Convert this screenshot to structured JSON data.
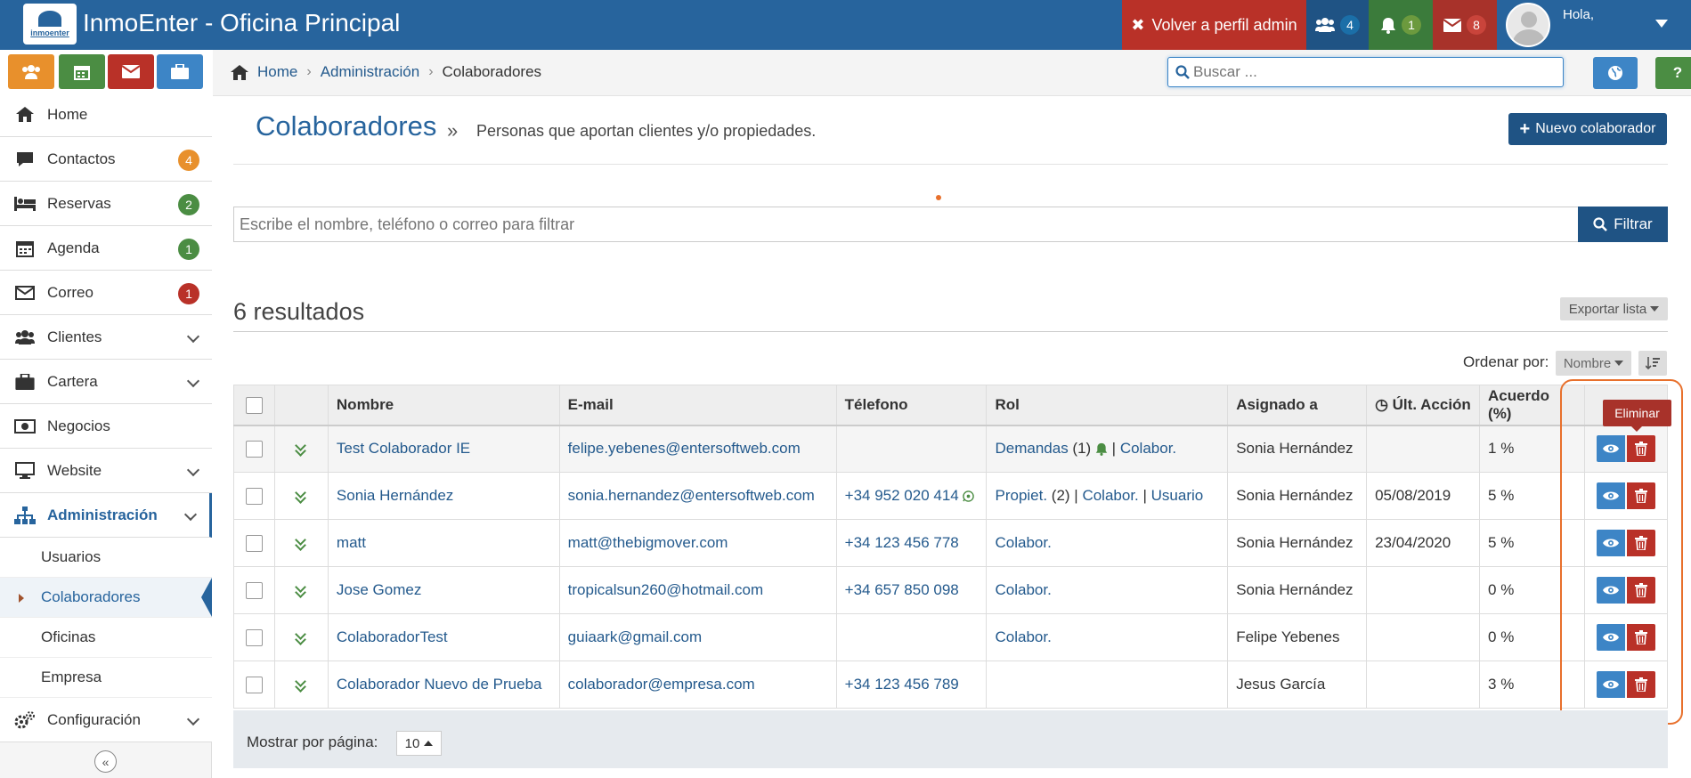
{
  "app": {
    "title": "InmoEnter - Oficina Principal",
    "logo_text": "inmoenter"
  },
  "topbar": {
    "admin_label": "Volver a perfil admin",
    "users_count": "4",
    "bell_count": "1",
    "mail_count": "8",
    "greeting": "Hola,"
  },
  "sidebar": {
    "items": [
      {
        "label": "Home"
      },
      {
        "label": "Contactos",
        "badge": "4"
      },
      {
        "label": "Reservas",
        "badge": "2"
      },
      {
        "label": "Agenda",
        "badge": "1"
      },
      {
        "label": "Correo",
        "badge": "1"
      },
      {
        "label": "Clientes"
      },
      {
        "label": "Cartera"
      },
      {
        "label": "Negocios"
      },
      {
        "label": "Website"
      },
      {
        "label": "Administración"
      },
      {
        "label": "Configuración"
      }
    ],
    "subitems": [
      {
        "label": "Usuarios"
      },
      {
        "label": "Colaboradores"
      },
      {
        "label": "Oficinas"
      },
      {
        "label": "Empresa"
      }
    ]
  },
  "breadcrumb": [
    "Home",
    "Administración",
    "Colaboradores"
  ],
  "search": {
    "placeholder": "Buscar ..."
  },
  "page": {
    "title": "Colaboradores",
    "sep": "»",
    "subtitle": "Personas que aportan clientes y/o propiedades.",
    "new_button": "Nuevo colaborador"
  },
  "filter": {
    "placeholder": "Escribe el nombre, teléfono o correo para filtrar",
    "button": "Filtrar"
  },
  "results": {
    "count_label": "6 resultados",
    "export_label": "Exportar lista",
    "sort_label": "Ordenar por:",
    "sort_value": "Nombre"
  },
  "table": {
    "headers": [
      "Nombre",
      "E-mail",
      "Télefono",
      "Rol",
      "Asignado a",
      "Últ. Acción",
      "Acuerdo (%)"
    ],
    "rows": [
      {
        "name": "Test Colaborador IE",
        "email": "felipe.yebenes@entersoftweb.com",
        "phone": "",
        "rol": [
          "Demandas",
          " (1) ",
          "|",
          "Colabor."
        ],
        "assigned": "Sonia Hernández",
        "last": "",
        "pct": "1 %"
      },
      {
        "name": "Sonia Hernández",
        "email": "sonia.hernandez@entersoftweb.com",
        "phone": "+34 952 020 414",
        "rol": [
          "Propiet.",
          " (2) | ",
          "Colabor.",
          " | ",
          "Usuario"
        ],
        "assigned": "Sonia Hernández",
        "last": "05/08/2019",
        "pct": "5 %"
      },
      {
        "name": "matt",
        "email": "matt@thebigmover.com",
        "phone": "+34 123 456 778",
        "rol": [
          "Colabor."
        ],
        "assigned": "Sonia Hernández",
        "last": "23/04/2020",
        "pct": "5 %"
      },
      {
        "name": "Jose Gomez",
        "email": "tropicalsun260@hotmail.com",
        "phone": "+34 657 850 098",
        "rol": [
          "Colabor."
        ],
        "assigned": "Sonia Hernández",
        "last": "",
        "pct": "0 %"
      },
      {
        "name": "ColaboradorTest",
        "email": "guiaark@gmail.com",
        "phone": "",
        "rol": [
          "Colabor."
        ],
        "assigned": "Felipe Yebenes",
        "last": "",
        "pct": "0 %"
      },
      {
        "name": "Colaborador Nuevo de Prueba",
        "email": "colaborador@empresa.com",
        "phone": "+34 123 456 789",
        "rol": [],
        "assigned": "Jesus García",
        "last": "",
        "pct": "3 %"
      }
    ]
  },
  "tooltip": "Eliminar",
  "pager": {
    "label": "Mostrar por página:",
    "value": "10"
  },
  "colors": {
    "brand": "#27649d",
    "danger": "#b93128",
    "success": "#4b8d43",
    "warning": "#e8902c"
  }
}
